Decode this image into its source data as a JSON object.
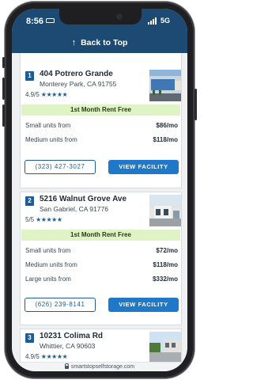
{
  "status_bar": {
    "time": "8:56",
    "network": "5G"
  },
  "top_bar": {
    "label": "Back to Top",
    "arrow": "↑"
  },
  "facilities": [
    {
      "number": "1",
      "title": "404 Potrero Grande",
      "city": "Monterey Park, CA 91755",
      "rating": "4.9/5",
      "stars": "★★★★★",
      "promo": "1st Month Rent Free",
      "units": [
        {
          "label": "Small units from",
          "price": "$86/mo"
        },
        {
          "label": "Medium units from",
          "price": "$118/mo"
        }
      ],
      "phone": "(323) 427-3027",
      "cta": "VIEW FACILITY"
    },
    {
      "number": "2",
      "title": "5216 Walnut Grove Ave",
      "city": "San Gabriel, CA 91776",
      "rating": "5/5",
      "stars": "★★★★★",
      "promo": "1st Month Rent Free",
      "units": [
        {
          "label": "Small units from",
          "price": "$72/mo"
        },
        {
          "label": "Medium units from",
          "price": "$118/mo"
        },
        {
          "label": "Large units from",
          "price": "$332/mo"
        }
      ],
      "phone": "(626) 239-8141",
      "cta": "VIEW FACILITY"
    },
    {
      "number": "3",
      "title": "10231 Colima Rd",
      "city": "Whittier, CA 90603",
      "rating": "4.9/5",
      "stars": "★★★★★"
    }
  ],
  "url_bar": {
    "domain": "smartstopselfstorage.com"
  },
  "colors": {
    "header": "#1c4a72",
    "accent": "#1f78c8",
    "promo_bg": "#def4c4"
  }
}
